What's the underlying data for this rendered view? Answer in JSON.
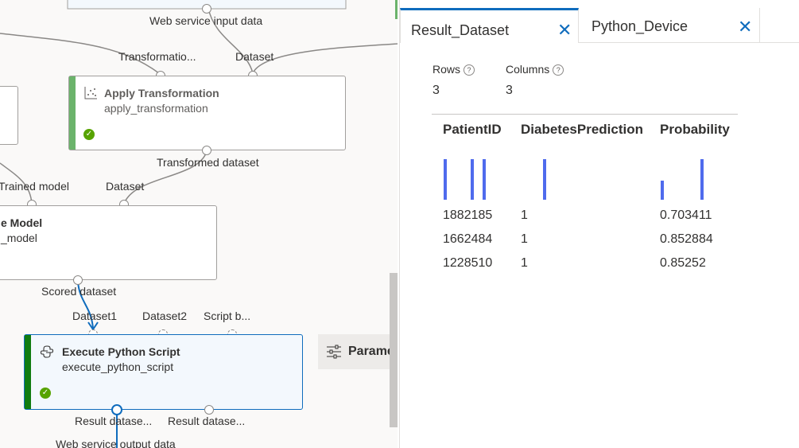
{
  "canvas": {
    "labels": {
      "web_service_input": "Web service input data",
      "transformation_port": "Transformatio...",
      "dataset_port_top": "Dataset",
      "transformed_dataset": "Transformed dataset",
      "trained_model": "Trained model",
      "dataset_port_mid": "Dataset",
      "scored_dataset": "Scored dataset",
      "dataset1": "Dataset1",
      "dataset2": "Dataset2",
      "script_bundle": "Script b...",
      "result_dataset_1": "Result datase...",
      "result_dataset_2": "Result datase...",
      "web_service_output": "Web service output data"
    },
    "nodes": {
      "apply_transformation": {
        "title": "Apply Transformation",
        "subtitle": "apply_transformation",
        "status_icon": "check-circle-icon",
        "accent": "#6bb36b"
      },
      "score_model": {
        "title": "e Model",
        "subtitle": "_model"
      },
      "execute_python": {
        "title": "Execute Python Script",
        "subtitle": "execute_python_script",
        "status_icon": "check-circle-icon",
        "accent": "#107c10"
      }
    },
    "parameters_button": {
      "label": "Parame",
      "icon": "sliders-icon"
    }
  },
  "panel": {
    "tabs": [
      {
        "label": "Result_Dataset",
        "close": "✕",
        "active": true
      },
      {
        "label": "Python_Device",
        "close": "✕",
        "active": false
      }
    ],
    "stats": {
      "rows_label": "Rows",
      "rows_value": "3",
      "columns_label": "Columns",
      "columns_value": "3",
      "help_icon": "?"
    },
    "table": {
      "headers": [
        "PatientID",
        "DiabetesPrediction",
        "Probability"
      ],
      "rows": [
        [
          "1882185",
          "1",
          "0.703411"
        ],
        [
          "1662484",
          "1",
          "0.852884"
        ],
        [
          "1228510",
          "1",
          "0.85252"
        ]
      ],
      "accent": "#4f6bed"
    }
  }
}
